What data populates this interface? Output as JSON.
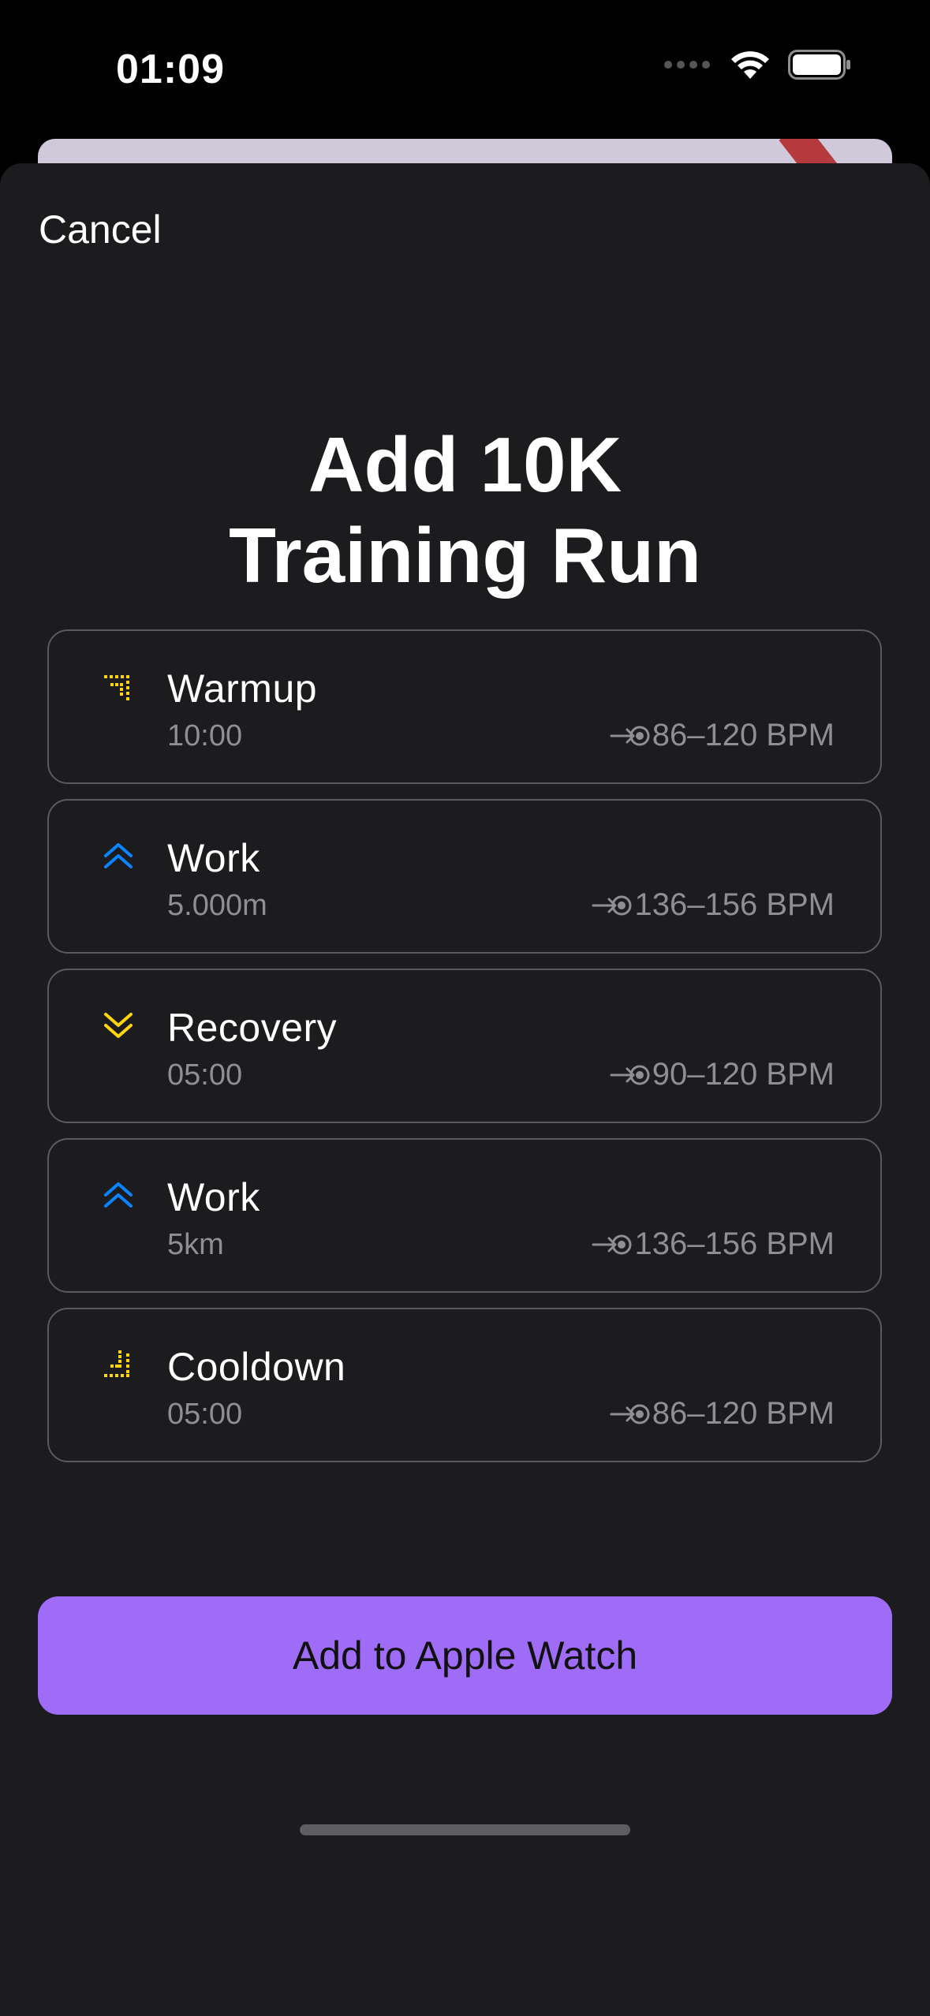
{
  "status_bar": {
    "time": "01:09"
  },
  "sheet": {
    "cancel_label": "Cancel",
    "title_line1": "Add 10K",
    "title_line2": "Training Run",
    "steps": [
      {
        "name": "Warmup",
        "detail": "10:00",
        "target": "86–120 BPM",
        "icon": "warmup-icon",
        "icon_color": "#ffd60a"
      },
      {
        "name": "Work",
        "detail": "5.000m",
        "target": "136–156 BPM",
        "icon": "chevron-double-up-icon",
        "icon_color": "#0a84ff"
      },
      {
        "name": "Recovery",
        "detail": "05:00",
        "target": "90–120 BPM",
        "icon": "chevron-double-down-icon",
        "icon_color": "#ffd60a"
      },
      {
        "name": "Work",
        "detail": "5km",
        "target": "136–156 BPM",
        "icon": "chevron-double-up-icon",
        "icon_color": "#0a84ff"
      },
      {
        "name": "Cooldown",
        "detail": "05:00",
        "target": "86–120 BPM",
        "icon": "cooldown-icon",
        "icon_color": "#ffd60a"
      }
    ],
    "add_button_label": "Add to Apple Watch"
  },
  "colors": {
    "accent": "#9f6cf8",
    "sheet_background": "#1c1c1e",
    "secondary_text": "#8e8e93"
  }
}
